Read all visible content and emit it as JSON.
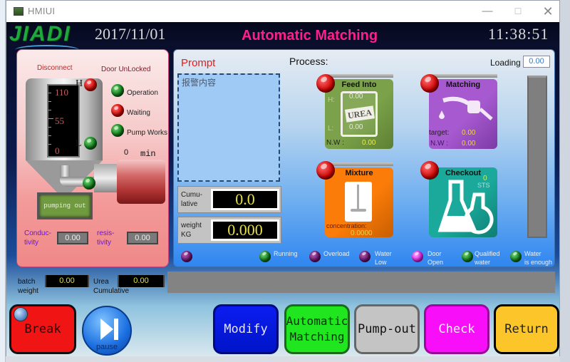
{
  "window": {
    "title": "HMIUI",
    "minimize": "—",
    "maximize": "☐",
    "close": "✕"
  },
  "header": {
    "logo": "JIADI",
    "date": "2017/11/01",
    "title": "Automatic Matching",
    "time": "11:38:51"
  },
  "left_panel": {
    "connection_status": "Disconnect",
    "door_status": "Door UnLocked",
    "tank_gauge": {
      "max": "110",
      "mid": "55",
      "min": "0",
      "high_label": "H",
      "low_label": "L"
    },
    "indicators": [
      {
        "label": "Operation",
        "state": "green"
      },
      {
        "label": "Waiting",
        "state": "red"
      },
      {
        "label": "Pump Works",
        "state": "green"
      }
    ],
    "timer": {
      "value": "0",
      "unit": "min"
    },
    "pump_display": "pumping out",
    "conductivity": {
      "label_1": "Conduc-",
      "label_2": "tivity",
      "value": "0.00"
    },
    "resistivity": {
      "label_1": "resis-",
      "label_2": "tivity",
      "value": "0.00"
    }
  },
  "bottom_readouts": {
    "batch_weight": {
      "label_1": "batch",
      "label_2": "weight",
      "value": "0.00"
    },
    "urea_cumulative": {
      "label_1": "Urea",
      "label_2": "Cumulative",
      "value": "0.00"
    }
  },
  "prompt": {
    "title": "Prompt",
    "content": "报警内容"
  },
  "readouts": {
    "cumulative": {
      "label_1": "Cumu-",
      "label_2": "lative",
      "value": "0.0"
    },
    "weight": {
      "label_1": "weight",
      "label_2": "KG",
      "value": "0.000"
    }
  },
  "process": {
    "title": "Process:",
    "loading_label": "Loading",
    "loading_value": "0.00",
    "tiles": {
      "feed": {
        "title": "Feed Into",
        "h_label": "H:",
        "h_value": "0.00",
        "l_label": "L:",
        "l_value": "0.00",
        "bag_text": "UREA",
        "nw_label": "N.W :",
        "nw_value": "0.00"
      },
      "matching": {
        "title": "Matching",
        "target_label": "target:",
        "target_value": "0.00",
        "nw_label": "N.W :",
        "nw_value": "0.00"
      },
      "mixture": {
        "title": "Mixture",
        "concentration_label": "concentration:",
        "concentration_value": "0.0000"
      },
      "checkout": {
        "title": "Checkout",
        "sts_value": "0",
        "sts_label": "STS"
      }
    }
  },
  "status_strip": [
    {
      "label": "",
      "color": "purple"
    },
    {
      "label": "Running",
      "color": "green"
    },
    {
      "label": "Overload",
      "color": "purple"
    },
    {
      "label": "Water Low",
      "color": "purple"
    },
    {
      "label": "Door Open",
      "color": "magenta"
    },
    {
      "label": "Qualified water",
      "color": "green"
    },
    {
      "label": "Water is enough",
      "color": "green"
    }
  ],
  "status_labels": {
    "running": "Running",
    "overload": "Overload",
    "water_low_1": "Water",
    "water_low_2": "Low",
    "door_open_1": "Door",
    "door_open_2": "Open",
    "qualified_1": "Qualified",
    "qualified_2": "water",
    "water_enough_1": "Water",
    "water_enough_2": "is enough"
  },
  "buttons": {
    "break": "Break",
    "pause": "pause",
    "modify": "Modify",
    "automatic_matching_1": "Automatic",
    "automatic_matching_2": "Matching",
    "pump_out": "Pump-out",
    "check": "Check",
    "return": "Return"
  },
  "colors": {
    "title_accent": "#ff1e8e",
    "logo": "#1fa83b",
    "lcd_text": "#e6e045",
    "break": "#f01414",
    "modify": "#0b1df0",
    "auto": "#1fe61f",
    "pump": "#c4c4c4",
    "check": "#f80ef8",
    "return": "#fcc62a"
  }
}
